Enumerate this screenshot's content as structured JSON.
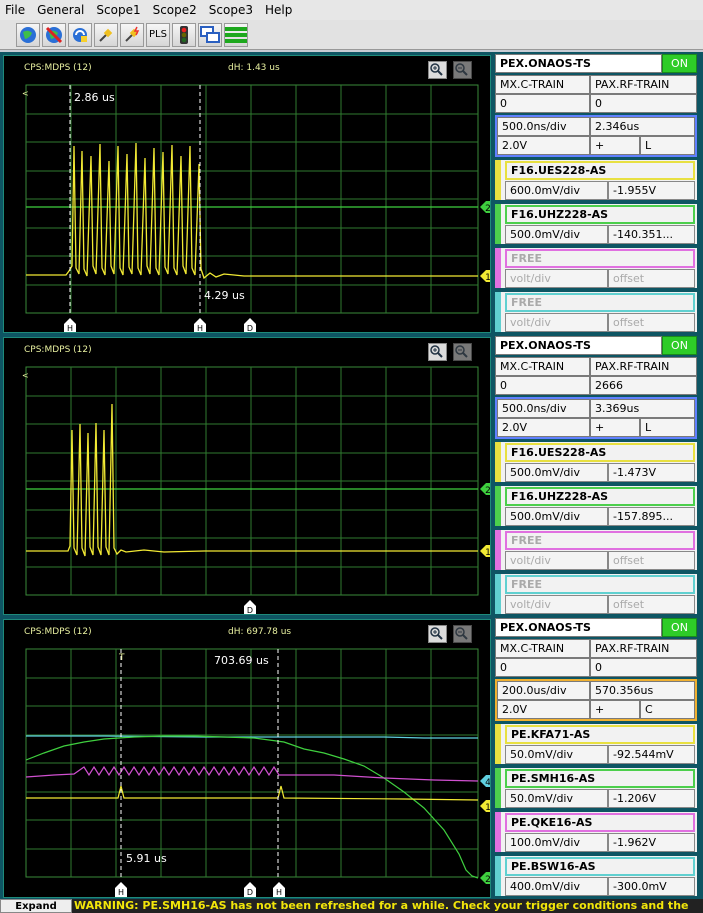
{
  "menu": [
    "File",
    "General",
    "Scope1",
    "Scope2",
    "Scope3",
    "Help"
  ],
  "toolbar": {
    "buttons": [
      "globe-icon",
      "no-globe-icon",
      "sync-icon",
      "plug-icon",
      "plug-spark-icon",
      "pls-button",
      "traffic-light-icon",
      "windows-icon",
      "green-bars-icon"
    ],
    "pls_label": "PLS"
  },
  "scopes": [
    {
      "header": "CPS:MDPS (12)",
      "dh": "dH: 1.43 us",
      "cursor_label_top": "2.86 us",
      "cursor_label_bottom": "4.29 us",
      "settings": {
        "device": "PEX.ONAOS-TS",
        "state": "ON",
        "col1_label": "MX.C-TRAIN",
        "col2_label": "PAX.RF-TRAIN",
        "col1_val": "0",
        "col2_val": "0",
        "timebase": "500.0ns/div",
        "delay": "2.346us",
        "trig_level": "2.0V",
        "slope": "+",
        "coupling": "L"
      },
      "channels": [
        {
          "name": "F16.UES228-AS",
          "scale": "600.0mV/div",
          "offset": "-1.955V",
          "color": "#e8e040"
        },
        {
          "name": "F16.UHZ228-AS",
          "scale": "500.0mV/div",
          "offset": "-140.351...",
          "color": "#4ccf4c"
        },
        {
          "name": "FREE",
          "scale": "volt/div",
          "offset": "offset",
          "color": "#e070e0"
        },
        {
          "name": "FREE",
          "scale": "volt/div",
          "offset": "offset",
          "color": "#60d0d0"
        }
      ]
    },
    {
      "header": "CPS:MDPS (12)",
      "dh": "",
      "settings": {
        "device": "PEX.ONAOS-TS",
        "state": "ON",
        "col1_label": "MX.C-TRAIN",
        "col2_label": "PAX.RF-TRAIN",
        "col1_val": "0",
        "col2_val": "2666",
        "timebase": "500.0ns/div",
        "delay": "3.369us",
        "trig_level": "2.0V",
        "slope": "+",
        "coupling": "L"
      },
      "channels": [
        {
          "name": "F16.UES228-AS",
          "scale": "500.0mV/div",
          "offset": "-1.473V",
          "color": "#e8e040"
        },
        {
          "name": "F16.UHZ228-AS",
          "scale": "500.0mV/div",
          "offset": "-157.895...",
          "color": "#4ccf4c"
        },
        {
          "name": "FREE",
          "scale": "volt/div",
          "offset": "offset",
          "color": "#e070e0"
        },
        {
          "name": "FREE",
          "scale": "volt/div",
          "offset": "offset",
          "color": "#60d0d0"
        }
      ]
    },
    {
      "header": "CPS:MDPS (12)",
      "dh": "dH: 697.78 us",
      "cursor_label_top": "703.69 us",
      "cursor_label_bottom": "5.91 us",
      "settings": {
        "device": "PEX.ONAOS-TS",
        "state": "ON",
        "col1_label": "MX.C-TRAIN",
        "col2_label": "PAX.RF-TRAIN",
        "col1_val": "0",
        "col2_val": "0",
        "timebase": "200.0us/div",
        "delay": "570.356us",
        "trig_level": "2.0V",
        "slope": "+",
        "coupling": "C"
      },
      "channels": [
        {
          "name": "PE.KFA71-AS",
          "scale": "50.0mV/div",
          "offset": "-92.544mV",
          "color": "#e8e040"
        },
        {
          "name": "PE.SMH16-AS",
          "scale": "50.0mV/div",
          "offset": "-1.206V",
          "color": "#4ccf4c"
        },
        {
          "name": "PE.QKE16-AS",
          "scale": "100.0mV/div",
          "offset": "-1.962V",
          "color": "#e070e0"
        },
        {
          "name": "PE.BSW16-AS",
          "scale": "400.0mV/div",
          "offset": "-300.0mV",
          "color": "#60d0d0"
        }
      ]
    }
  ],
  "markers": {
    "h": "H",
    "d": "D",
    "ch1": "1",
    "ch2": "2",
    "ch4": "4"
  },
  "status": {
    "expand_label": "Expand",
    "warning": "WARNING: PE.SMH16-AS has not been refreshed for a while. Check your trigger conditions and the"
  }
}
